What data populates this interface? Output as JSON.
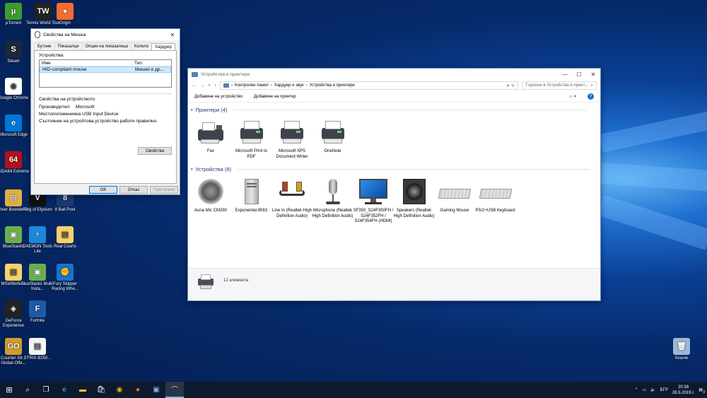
{
  "desktop": {
    "icons": [
      {
        "label": "µTorrent",
        "color": "#3c9b2f",
        "glyph": "µ"
      },
      {
        "label": "Tennis World Tour",
        "color": "#222222",
        "glyph": "TW"
      },
      {
        "label": "Origin",
        "color": "#f56c2d",
        "glyph": "●"
      },
      {
        "label": "Steam",
        "color": "#1b2838",
        "glyph": "S"
      },
      {
        "label": "Google Chrome",
        "color": "#ffffff",
        "glyph": "◉"
      },
      {
        "label": "Microsoft Edge",
        "color": "#0078d7",
        "glyph": "e"
      },
      {
        "label": "AIDA64 Extreme",
        "color": "#b2111a",
        "glyph": "64"
      },
      {
        "label": "Driver Booster P...",
        "color": "#e0b040",
        "glyph": "▤"
      },
      {
        "label": "Ring of Elysium",
        "color": "#111111",
        "glyph": "V"
      },
      {
        "label": "8 Ball Pool",
        "color": "#1d3a72",
        "glyph": "8"
      },
      {
        "label": "BlueStacks",
        "color": "#6ab04c",
        "glyph": "▣"
      },
      {
        "label": "DAEMON Tools Lite",
        "color": "#1a88d8",
        "glyph": "⚡"
      },
      {
        "label": "Real Courts",
        "color": "#f5d26b",
        "glyph": "▤"
      },
      {
        "label": "MSIAfterbu...",
        "color": "#f5d26b",
        "glyph": "▤"
      },
      {
        "label": "BlueStacks Multi-Insta...",
        "color": "#6ab04c",
        "glyph": "▣"
      },
      {
        "label": "Fury Skipper Racing Whe...",
        "color": "#1a74c8",
        "glyph": "✊"
      },
      {
        "label": "GeForce Experience",
        "color": "#222222",
        "glyph": "◈"
      },
      {
        "label": "Fortnite",
        "color": "#1e5aa8",
        "glyph": "F"
      },
      {
        "label": "Counter-Str... Global Offe...",
        "color": "#d29c2a",
        "glyph": "GO"
      },
      {
        "label": "STRIX-B250...",
        "color": "#f5f5f5",
        "glyph": "▤"
      },
      {
        "label": "Кошче",
        "color": "#9cb8d6",
        "glyph": "🗑"
      }
    ]
  },
  "mouse_dialog": {
    "title": "Свойства на Мишка",
    "tabs": [
      "Бутони",
      "Показалци",
      "Опции на показалеца",
      "Колело",
      "Хардуер"
    ],
    "devices_label": "Устройства:",
    "col_name": "Име",
    "col_type": "Тип",
    "device_name": "HID-compliant mouse",
    "device_type": "Мишки и др...",
    "props_heading": "Свойства на устройството",
    "manufacturer_label": "Производител:",
    "manufacturer_value": "Microsoft",
    "location_label": "Местоположение:",
    "location_value": "на USB Input Device",
    "status_text": "Състояние на устройтова устройство работи правилно.",
    "properties_button": "Свойства",
    "ok_button": "OK",
    "cancel_button": "Отказ",
    "apply_button": "Прилагане"
  },
  "explorer": {
    "title": "Устройства и принтери",
    "breadcrumb": [
      "Контролен панел",
      "Хардуер и звук",
      "Устройства и принтери"
    ],
    "search_placeholder": "Търсене в Устройства и принт...",
    "add_device": "Добавяне на устройство",
    "add_printer": "Добавяне на принтер",
    "printers_group": "Принтери (4)",
    "devices_group": "Устройства (8)",
    "printers": [
      {
        "label": "Fax",
        "icon": "fax-icon"
      },
      {
        "label": "Microsoft Print to PDF",
        "icon": "printer-icon"
      },
      {
        "label": "Microsoft XPS Document Writer",
        "icon": "printer-icon"
      },
      {
        "label": "OneNote",
        "icon": "printer-icon"
      }
    ],
    "devices": [
      {
        "label": "Auna Mic CM280",
        "icon": "speaker-icon"
      },
      {
        "label": "Exponental-9063",
        "icon": "computer-tower-icon"
      },
      {
        "label": "Line In (Realtek High Definition Audio)",
        "icon": "audio-cable-icon"
      },
      {
        "label": "Microphone (Realtek High Definition Audio)",
        "icon": "microphone-icon"
      },
      {
        "label": "SF350_S24F350FH / S24F352FH / S24F354FH (HDMI)",
        "icon": "monitor-icon"
      },
      {
        "label": "Speakers (Realtek High Definition Audio)",
        "icon": "speaker-box-icon"
      },
      {
        "label": "Gaming Mouse",
        "icon": "keyboard-icon"
      },
      {
        "label": "PS/2+USB Keyboard",
        "icon": "keyboard-icon"
      }
    ],
    "status_count": "12 елемента"
  },
  "taskbar": {
    "lang": "БГР",
    "time": "20:38",
    "date": "28.5.2019 г.",
    "notif_count": "3"
  }
}
